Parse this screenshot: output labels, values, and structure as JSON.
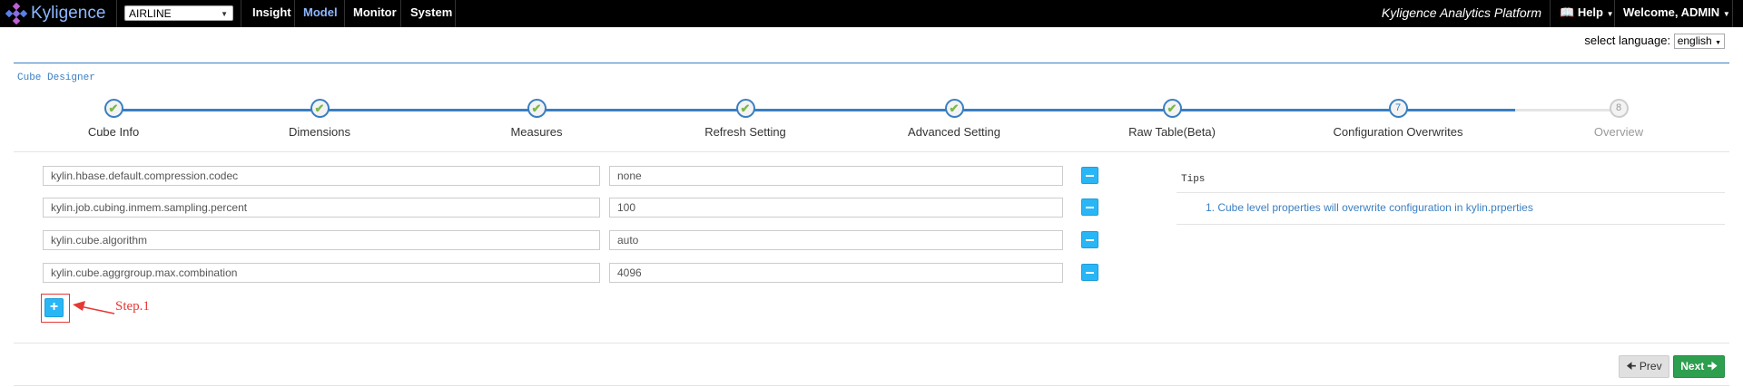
{
  "header": {
    "brand": "Kyligence",
    "project_select": "AIRLINE",
    "nav": [
      "Insight",
      "Model",
      "Monitor",
      "System"
    ],
    "active_nav": "Model",
    "platform": "Kyligence Analytics Platform",
    "help": "Help",
    "welcome": "Welcome, ADMIN"
  },
  "language": {
    "label": "select language:",
    "value": "english"
  },
  "designer": {
    "title": "Cube Designer",
    "steps": [
      {
        "label": "Cube Info",
        "state": "done"
      },
      {
        "label": "Dimensions",
        "state": "done"
      },
      {
        "label": "Measures",
        "state": "done"
      },
      {
        "label": "Refresh Setting",
        "state": "done"
      },
      {
        "label": "Advanced Setting",
        "state": "done"
      },
      {
        "label": "Raw Table(Beta)",
        "state": "done"
      },
      {
        "label": "Configuration Overwrites",
        "state": "current",
        "number": "7"
      },
      {
        "label": "Overview",
        "state": "pending",
        "number": "8"
      }
    ]
  },
  "properties": [
    {
      "key": "kylin.hbase.default.compression.codec",
      "value": "none"
    },
    {
      "key": "kylin.job.cubing.inmem.sampling.percent",
      "value": "100"
    },
    {
      "key": "kylin.cube.algorithm",
      "value": "auto"
    },
    {
      "key": "kylin.cube.aggrgroup.max.combination",
      "value": "4096"
    }
  ],
  "annotation": {
    "text": "Step.1"
  },
  "tips": {
    "title": "Tips",
    "items": [
      "1. Cube level properties will overwrite configuration in kylin.prperties"
    ]
  },
  "footer": {
    "prev": "Prev",
    "next": "Next"
  },
  "colors": {
    "accent": "#3a7fc1",
    "check": "#7cb84a",
    "button": "#29b6f6",
    "next": "#2e9e4f",
    "annotation": "#e53935"
  }
}
